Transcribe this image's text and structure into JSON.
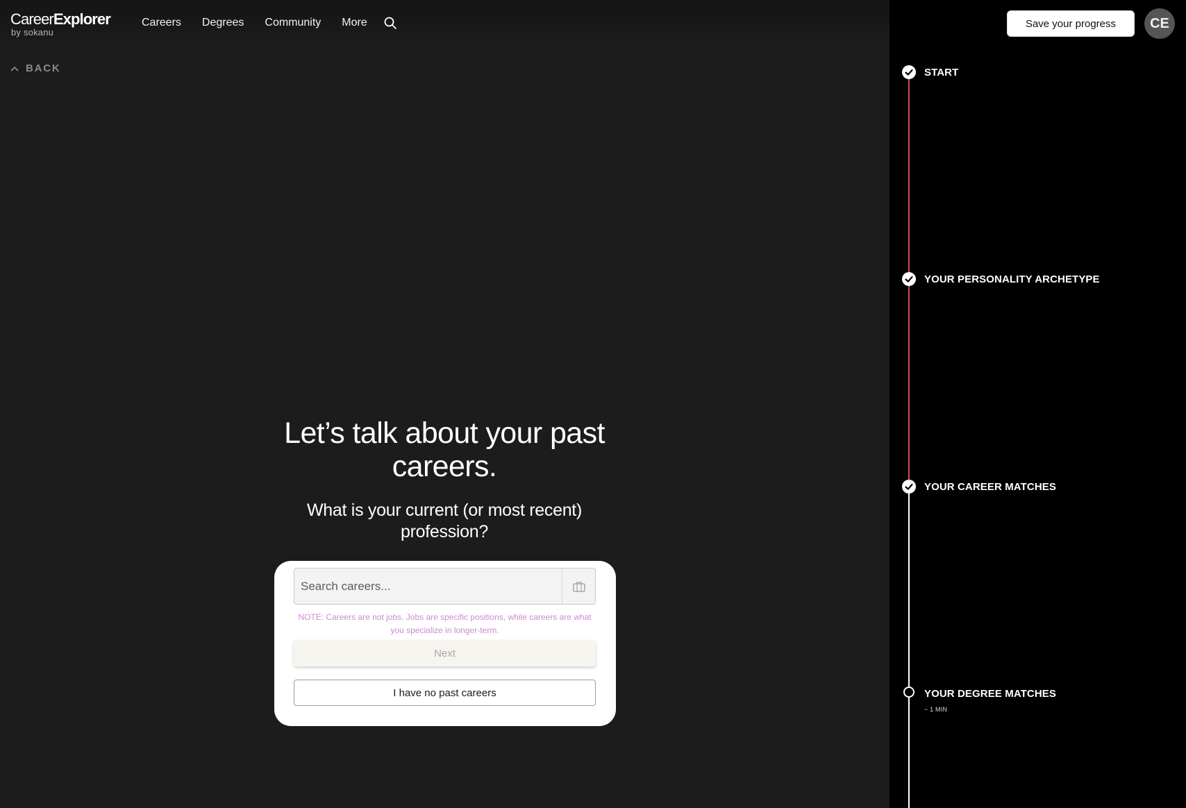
{
  "header": {
    "logo_main_a": "Career",
    "logo_main_b": "Explorer",
    "logo_sub": "by sokanu",
    "nav": [
      "Careers",
      "Degrees",
      "Community",
      "More"
    ],
    "search_icon": "search-icon"
  },
  "back": {
    "label": "BACK",
    "icon": "chevron-up-icon"
  },
  "question": {
    "headline": "Let’s talk about your past careers.",
    "subheadline": "What is your current (or most recent) profession?"
  },
  "form": {
    "search_placeholder": "Search careers...",
    "search_value": "",
    "field_icon": "briefcase-icon",
    "note": "NOTE: Careers are not jobs. Jobs are specific positions, while careers are what you specialize in longer-term.",
    "next_label": "Next",
    "no_past_label": "I have no past careers"
  },
  "side": {
    "save_label": "Save your progress",
    "avatar_initials": "CE",
    "steps": [
      {
        "label": "START",
        "status": "done",
        "sub": ""
      },
      {
        "label": "YOUR PERSONALITY ARCHETYPE",
        "status": "done",
        "sub": ""
      },
      {
        "label": "YOUR CAREER MATCHES",
        "status": "done",
        "sub": ""
      },
      {
        "label": "YOUR DEGREE MATCHES",
        "status": "todo",
        "sub": "~ 1 MIN"
      }
    ]
  },
  "colors": {
    "background": "#1c1c1c",
    "panel": "#000000",
    "timeline_done": "#c8475a",
    "timeline_todo": "#ffffff",
    "note": "#c98bd0"
  }
}
